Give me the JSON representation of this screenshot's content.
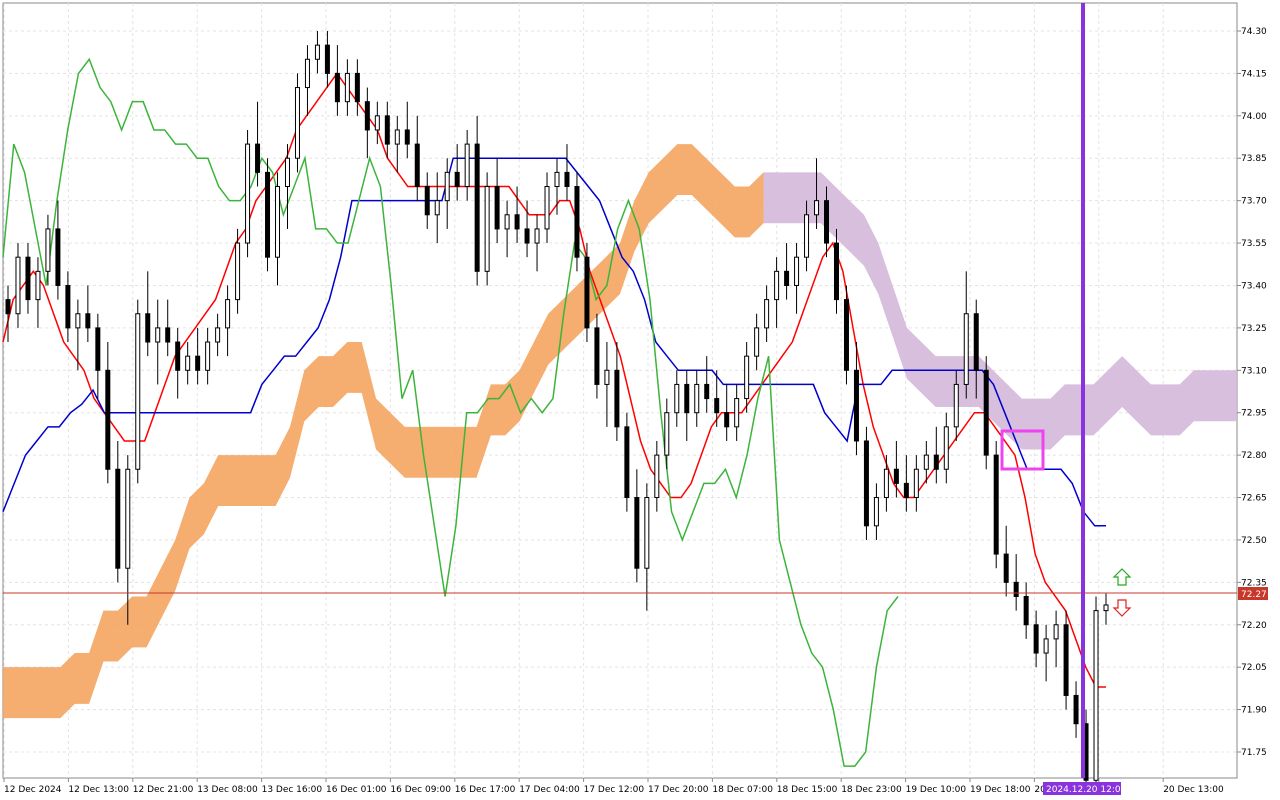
{
  "chart_data": {
    "type": "candlestick",
    "title": "",
    "xlabel": "",
    "ylabel": "",
    "ylim": [
      71.58,
      74.36
    ],
    "grid": true,
    "y_ticks": [
      "74.30",
      "74.15",
      "74.00",
      "73.85",
      "73.70",
      "73.55",
      "73.40",
      "73.25",
      "73.10",
      "72.95",
      "72.80",
      "72.65",
      "72.50",
      "72.35",
      "72.20",
      "72.05",
      "71.90",
      "71.75"
    ],
    "x_ticks": [
      "12 Dec 2024",
      "12 Dec 13:00",
      "12 Dec 21:00",
      "13 Dec 08:00",
      "13 Dec 16:00",
      "16 Dec 01:00",
      "16 Dec 09:00",
      "16 Dec 17:00",
      "17 Dec 04:00",
      "17 Dec 12:00",
      "17 Dec 20:00",
      "18 Dec 07:00",
      "18 Dec 15:00",
      "18 Dec 23:00",
      "19 Dec 10:00",
      "19 Dec 18:00",
      "20 Dec 02:00",
      "",
      "20 Dec 13:00"
    ],
    "current_price": 72.27,
    "cursor_time": "2024.12.20 12:00",
    "candles": [
      [
        73.35,
        73.4,
        73.2,
        73.3
      ],
      [
        73.3,
        73.55,
        73.25,
        73.5
      ],
      [
        73.5,
        73.55,
        73.3,
        73.35
      ],
      [
        73.35,
        73.5,
        73.25,
        73.45
      ],
      [
        73.45,
        73.65,
        73.4,
        73.6
      ],
      [
        73.6,
        73.7,
        73.35,
        73.4
      ],
      [
        73.4,
        73.45,
        73.2,
        73.25
      ],
      [
        73.25,
        73.35,
        73.1,
        73.3
      ],
      [
        73.3,
        73.4,
        73.2,
        73.25
      ],
      [
        73.25,
        73.3,
        73.0,
        73.1
      ],
      [
        73.1,
        73.2,
        72.7,
        72.75
      ],
      [
        72.75,
        72.85,
        72.35,
        72.4
      ],
      [
        72.4,
        72.8,
        72.2,
        72.75
      ],
      [
        72.75,
        73.35,
        72.7,
        73.3
      ],
      [
        73.3,
        73.45,
        73.15,
        73.2
      ],
      [
        73.2,
        73.35,
        73.05,
        73.25
      ],
      [
        73.25,
        73.35,
        73.15,
        73.2
      ],
      [
        73.2,
        73.25,
        73.0,
        73.1
      ],
      [
        73.1,
        73.2,
        73.05,
        73.15
      ],
      [
        73.15,
        73.25,
        73.05,
        73.1
      ],
      [
        73.1,
        73.25,
        73.05,
        73.2
      ],
      [
        73.2,
        73.3,
        73.15,
        73.25
      ],
      [
        73.25,
        73.4,
        73.15,
        73.35
      ],
      [
        73.35,
        73.6,
        73.3,
        73.55
      ],
      [
        73.55,
        73.95,
        73.5,
        73.9
      ],
      [
        73.9,
        74.05,
        73.75,
        73.8
      ],
      [
        73.8,
        73.85,
        73.45,
        73.5
      ],
      [
        73.5,
        73.8,
        73.4,
        73.75
      ],
      [
        73.75,
        73.9,
        73.6,
        73.85
      ],
      [
        73.85,
        74.15,
        73.8,
        74.1
      ],
      [
        74.1,
        74.25,
        74.0,
        74.2
      ],
      [
        74.2,
        74.3,
        74.15,
        74.25
      ],
      [
        74.25,
        74.3,
        74.1,
        74.15
      ],
      [
        74.15,
        74.25,
        74.0,
        74.05
      ],
      [
        74.05,
        74.2,
        74.0,
        74.15
      ],
      [
        74.15,
        74.2,
        74.0,
        74.05
      ],
      [
        74.05,
        74.1,
        73.85,
        73.95
      ],
      [
        73.95,
        74.05,
        73.9,
        74.0
      ],
      [
        74.0,
        74.05,
        73.85,
        73.9
      ],
      [
        73.9,
        74.0,
        73.8,
        73.95
      ],
      [
        73.95,
        74.05,
        73.85,
        73.9
      ],
      [
        73.9,
        74.0,
        73.7,
        73.75
      ],
      [
        73.75,
        73.8,
        73.6,
        73.65
      ],
      [
        73.65,
        73.8,
        73.55,
        73.7
      ],
      [
        73.7,
        73.85,
        73.6,
        73.8
      ],
      [
        73.8,
        73.9,
        73.7,
        73.75
      ],
      [
        73.75,
        73.95,
        73.7,
        73.9
      ],
      [
        73.9,
        74.0,
        73.4,
        73.45
      ],
      [
        73.45,
        73.8,
        73.4,
        73.75
      ],
      [
        73.75,
        73.85,
        73.55,
        73.6
      ],
      [
        73.6,
        73.7,
        73.5,
        73.65
      ],
      [
        73.65,
        73.75,
        73.55,
        73.6
      ],
      [
        73.6,
        73.7,
        73.5,
        73.55
      ],
      [
        73.55,
        73.65,
        73.45,
        73.6
      ],
      [
        73.6,
        73.8,
        73.55,
        73.75
      ],
      [
        73.75,
        73.85,
        73.65,
        73.8
      ],
      [
        73.8,
        73.9,
        73.7,
        73.75
      ],
      [
        73.75,
        73.8,
        73.45,
        73.5
      ],
      [
        73.5,
        73.55,
        73.2,
        73.25
      ],
      [
        73.25,
        73.3,
        73.0,
        73.05
      ],
      [
        73.05,
        73.2,
        72.9,
        73.1
      ],
      [
        73.1,
        73.2,
        72.85,
        72.9
      ],
      [
        72.9,
        72.95,
        72.6,
        72.65
      ],
      [
        72.65,
        72.75,
        72.35,
        72.4
      ],
      [
        72.4,
        72.7,
        72.25,
        72.65
      ],
      [
        72.65,
        72.85,
        72.6,
        72.8
      ],
      [
        72.8,
        73.0,
        72.75,
        72.95
      ],
      [
        72.95,
        73.1,
        72.9,
        73.05
      ],
      [
        73.05,
        73.1,
        72.85,
        72.95
      ],
      [
        72.95,
        73.1,
        72.9,
        73.05
      ],
      [
        73.05,
        73.15,
        72.95,
        73.0
      ],
      [
        73.0,
        73.1,
        72.9,
        72.95
      ],
      [
        72.95,
        73.05,
        72.85,
        72.9
      ],
      [
        72.9,
        73.05,
        72.85,
        73.0
      ],
      [
        73.0,
        73.2,
        72.95,
        73.15
      ],
      [
        73.15,
        73.3,
        73.1,
        73.25
      ],
      [
        73.25,
        73.4,
        73.2,
        73.35
      ],
      [
        73.35,
        73.5,
        73.25,
        73.45
      ],
      [
        73.45,
        73.55,
        73.35,
        73.4
      ],
      [
        73.4,
        73.55,
        73.3,
        73.5
      ],
      [
        73.5,
        73.7,
        73.45,
        73.65
      ],
      [
        73.65,
        73.85,
        73.6,
        73.7
      ],
      [
        73.7,
        73.75,
        73.5,
        73.55
      ],
      [
        73.55,
        73.6,
        73.3,
        73.35
      ],
      [
        73.35,
        73.4,
        73.05,
        73.1
      ],
      [
        73.1,
        73.2,
        72.8,
        72.85
      ],
      [
        72.85,
        72.9,
        72.5,
        72.55
      ],
      [
        72.55,
        72.7,
        72.5,
        72.65
      ],
      [
        72.65,
        72.8,
        72.6,
        72.75
      ],
      [
        72.75,
        72.85,
        72.65,
        72.7
      ],
      [
        72.7,
        72.8,
        72.6,
        72.65
      ],
      [
        72.65,
        72.8,
        72.6,
        72.75
      ],
      [
        72.75,
        72.85,
        72.7,
        72.8
      ],
      [
        72.8,
        72.9,
        72.7,
        72.75
      ],
      [
        72.75,
        72.95,
        72.7,
        72.9
      ],
      [
        72.9,
        73.1,
        72.85,
        73.05
      ],
      [
        73.05,
        73.45,
        73.0,
        73.3
      ],
      [
        73.3,
        73.35,
        73.0,
        73.1
      ],
      [
        73.1,
        73.15,
        72.75,
        72.8
      ],
      [
        72.8,
        72.85,
        72.4,
        72.45
      ],
      [
        72.45,
        72.55,
        72.3,
        72.35
      ],
      [
        72.35,
        72.45,
        72.25,
        72.3
      ],
      [
        72.3,
        72.35,
        72.15,
        72.2
      ],
      [
        72.2,
        72.25,
        72.05,
        72.1
      ],
      [
        72.1,
        72.2,
        72.0,
        72.15
      ],
      [
        72.15,
        72.25,
        72.05,
        72.2
      ],
      [
        72.2,
        72.25,
        71.9,
        71.95
      ],
      [
        71.95,
        72.0,
        71.8,
        71.85
      ],
      [
        71.85,
        71.9,
        71.62,
        71.65
      ],
      [
        71.65,
        72.3,
        71.62,
        72.25
      ],
      [
        72.25,
        72.31,
        72.2,
        72.27
      ]
    ],
    "series": [
      {
        "name": "",
        "color": "#ff0000",
        "values": [
          73.2,
          73.35,
          73.4,
          73.45,
          73.4,
          73.3,
          73.2,
          73.15,
          73.1,
          73.0,
          72.95,
          72.9,
          72.85,
          72.85,
          72.85,
          72.95,
          73.05,
          73.15,
          73.2,
          73.25,
          73.3,
          73.35,
          73.45,
          73.55,
          73.6,
          73.7,
          73.75,
          73.8,
          73.85,
          73.95,
          74.0,
          74.05,
          74.1,
          74.15,
          74.1,
          74.05,
          74.0,
          73.95,
          73.85,
          73.8,
          73.75,
          73.75,
          73.75,
          73.75,
          73.75,
          73.75,
          73.75,
          73.75,
          73.75,
          73.75,
          73.75,
          73.7,
          73.65,
          73.65,
          73.65,
          73.7,
          73.7,
          73.6,
          73.45,
          73.35,
          73.25,
          73.15,
          73.0,
          72.85,
          72.75,
          72.7,
          72.65,
          72.65,
          72.7,
          72.8,
          72.9,
          72.95,
          72.95,
          72.95,
          73.0,
          73.05,
          73.1,
          73.15,
          73.2,
          73.3,
          73.4,
          73.5,
          73.55,
          73.45,
          73.25,
          73.05,
          72.9,
          72.8,
          72.7,
          72.65,
          72.65,
          72.7,
          72.75,
          72.8,
          72.85,
          72.9,
          72.95,
          72.95,
          72.9,
          72.85,
          72.8,
          72.65,
          72.45,
          72.35,
          72.3,
          72.25,
          72.15,
          72.05,
          71.98,
          71.98
        ]
      },
      {
        "name": "",
        "color": "#0000cc",
        "values": [
          72.6,
          72.7,
          72.8,
          72.85,
          72.9,
          72.9,
          72.95,
          72.98,
          73.03,
          72.95,
          72.95,
          72.95,
          72.95,
          72.95,
          72.95,
          72.95,
          72.95,
          72.95,
          72.95,
          72.95,
          72.95,
          72.95,
          72.95,
          73.05,
          73.1,
          73.15,
          73.15,
          73.2,
          73.25,
          73.35,
          73.5,
          73.7,
          73.7,
          73.7,
          73.7,
          73.7,
          73.7,
          73.7,
          73.7,
          73.7,
          73.85,
          73.85,
          73.85,
          73.85,
          73.85,
          73.85,
          73.85,
          73.85,
          73.85,
          73.85,
          73.85,
          73.8,
          73.75,
          73.7,
          73.6,
          73.5,
          73.45,
          73.35,
          73.2,
          73.15,
          73.1,
          73.1,
          73.1,
          73.1,
          73.05,
          73.05,
          73.05,
          73.05,
          73.05,
          73.05,
          73.05,
          73.05,
          73.05,
          72.95,
          72.9,
          72.85,
          73.05,
          73.05,
          73.05,
          73.1,
          73.1,
          73.1,
          73.1,
          73.1,
          73.1,
          73.1,
          73.1,
          73.1,
          73.05,
          72.95,
          72.85,
          72.75,
          72.75,
          72.75,
          72.75,
          72.7,
          72.6,
          72.55,
          72.55
        ]
      },
      {
        "name": "",
        "color": "#3cb43c",
        "values": [
          73.5,
          73.9,
          73.8,
          73.6,
          73.4,
          73.7,
          73.95,
          74.15,
          74.2,
          74.1,
          74.05,
          73.95,
          74.05,
          74.05,
          73.95,
          73.95,
          73.9,
          73.9,
          73.85,
          73.85,
          73.75,
          73.7,
          73.7,
          73.75,
          73.85,
          73.8,
          73.65,
          73.75,
          73.85,
          73.6,
          73.6,
          73.55,
          73.55,
          73.7,
          73.85,
          73.75,
          73.4,
          73.0,
          73.1,
          72.8,
          72.55,
          72.3,
          72.55,
          72.95,
          72.95,
          73.0,
          73.0,
          73.05,
          72.95,
          73.0,
          72.95,
          73.0,
          73.3,
          73.55,
          73.5,
          73.35,
          73.4,
          73.6,
          73.7,
          73.6,
          73.35,
          72.95,
          72.6,
          72.5,
          72.6,
          72.7,
          72.7,
          72.75,
          72.65,
          72.8,
          73.0,
          73.15,
          72.5,
          72.35,
          72.2,
          72.1,
          72.05,
          71.9,
          71.7,
          71.7,
          71.75,
          72.05,
          72.25,
          72.3
        ]
      }
    ],
    "cloud": {
      "color_up": "#f4a460",
      "color_down": "#d3b8d9",
      "values_upper": [
        72.05,
        72.05,
        72.05,
        72.05,
        72.05,
        72.1,
        72.1,
        72.25,
        72.25,
        72.3,
        72.3,
        72.4,
        72.5,
        72.65,
        72.7,
        72.8,
        72.8,
        72.8,
        72.8,
        72.8,
        72.9,
        73.1,
        73.15,
        73.15,
        73.2,
        73.2,
        73.0,
        72.95,
        72.9,
        72.9,
        72.9,
        72.9,
        72.9,
        72.9,
        73.05,
        73.05,
        73.1,
        73.2,
        73.3,
        73.35,
        73.4,
        73.45,
        73.5,
        73.55,
        73.7,
        73.8,
        73.85,
        73.9,
        73.9,
        73.85,
        73.8,
        73.75,
        73.75,
        73.8,
        73.8,
        73.8,
        73.8,
        73.8,
        73.75,
        73.7,
        73.65,
        73.55,
        73.4,
        73.25,
        73.2,
        73.15,
        73.15,
        73.15,
        73.15,
        73.1,
        73.05,
        73.0,
        73.0,
        73.0,
        73.05,
        73.05,
        73.05,
        73.1,
        73.15,
        73.1,
        73.05,
        73.05,
        73.05,
        73.1,
        73.1,
        73.1,
        73.1
      ]
    }
  }
}
